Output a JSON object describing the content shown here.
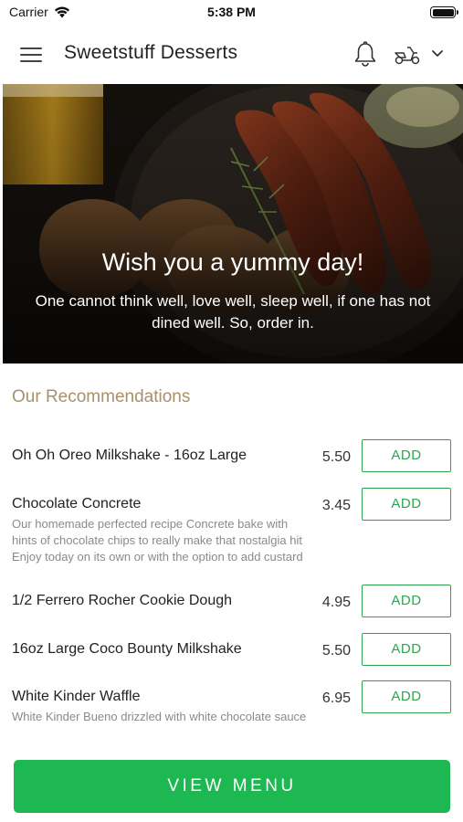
{
  "status": {
    "carrier": "Carrier",
    "time": "5:38 PM"
  },
  "header": {
    "title": "Sweetstuff Desserts",
    "icons": [
      "menu-icon",
      "bell-icon",
      "scooter-icon",
      "chevron-down-icon"
    ]
  },
  "hero": {
    "title": "Wish you a yummy day!",
    "subtitle": "One cannot think well, love well, sleep well, if one has not dined well. So, order in."
  },
  "recommendations": {
    "title": "Our Recommendations",
    "items": [
      {
        "name": "Oh Oh Oreo Milkshake - 16oz Large",
        "description": "",
        "price": "5.50",
        "button": "ADD"
      },
      {
        "name": "Chocolate Concrete",
        "description": "Our homemade perfected recipe Concrete bake with hints of chocolate chips to really make that nostalgia hit Enjoy today on its own or with the option to add custard",
        "price": "3.45",
        "button": "ADD"
      },
      {
        "name": "1/2 Ferrero Rocher Cookie Dough",
        "description": "",
        "price": "4.95",
        "button": "ADD"
      },
      {
        "name": "16oz Large Coco Bounty Milkshake",
        "description": "",
        "price": "5.50",
        "button": "ADD"
      },
      {
        "name": "White Kinder Waffle",
        "description": "White Kinder Bueno drizzled with white chocolate sauce",
        "price": "6.95",
        "button": "ADD"
      }
    ]
  },
  "footer": {
    "button": "VIEW MENU"
  },
  "colors": {
    "accent_green": "#1eb852",
    "outline_green": "#2ea44f",
    "section_title": "#a8906a"
  }
}
